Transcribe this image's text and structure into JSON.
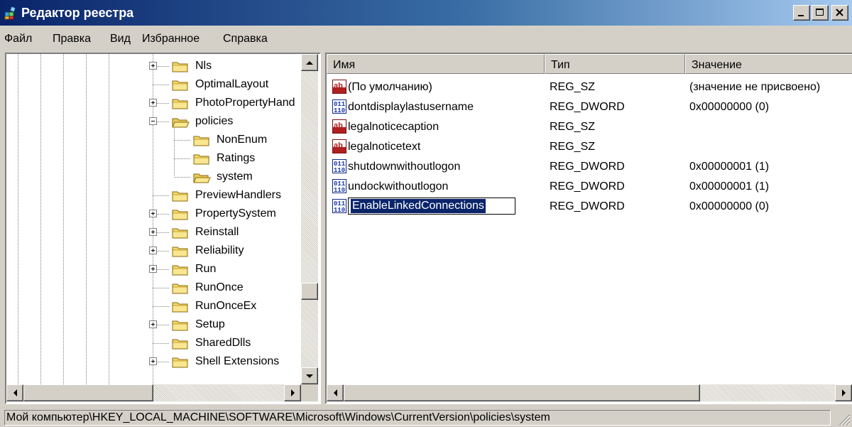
{
  "window": {
    "title": "Редактор реестра"
  },
  "menu": [
    "Файл",
    "Правка",
    "Вид",
    "Избранное",
    "Справка"
  ],
  "tree": {
    "items": [
      {
        "label": "Nls",
        "expander": "plus",
        "indent": 0,
        "open": false
      },
      {
        "label": "OptimalLayout",
        "expander": "none",
        "indent": 0,
        "open": false
      },
      {
        "label": "PhotoPropertyHand",
        "expander": "plus",
        "indent": 0,
        "open": false
      },
      {
        "label": "policies",
        "expander": "minus",
        "indent": 0,
        "open": true
      },
      {
        "label": "NonEnum",
        "expander": "none",
        "indent": 1,
        "open": false
      },
      {
        "label": "Ratings",
        "expander": "none",
        "indent": 1,
        "open": false
      },
      {
        "label": "system",
        "expander": "none",
        "indent": 1,
        "open": true
      },
      {
        "label": "PreviewHandlers",
        "expander": "none",
        "indent": 0,
        "open": false
      },
      {
        "label": "PropertySystem",
        "expander": "plus",
        "indent": 0,
        "open": false
      },
      {
        "label": "Reinstall",
        "expander": "plus",
        "indent": 0,
        "open": false
      },
      {
        "label": "Reliability",
        "expander": "plus",
        "indent": 0,
        "open": false
      },
      {
        "label": "Run",
        "expander": "plus",
        "indent": 0,
        "open": false
      },
      {
        "label": "RunOnce",
        "expander": "none",
        "indent": 0,
        "open": false
      },
      {
        "label": "RunOnceEx",
        "expander": "none",
        "indent": 0,
        "open": false
      },
      {
        "label": "Setup",
        "expander": "plus",
        "indent": 0,
        "open": false
      },
      {
        "label": "SharedDlls",
        "expander": "none",
        "indent": 0,
        "open": false
      },
      {
        "label": "Shell Extensions",
        "expander": "plus",
        "indent": 0,
        "open": false
      }
    ]
  },
  "list": {
    "columns": [
      "Имя",
      "Тип",
      "Значение"
    ],
    "rows": [
      {
        "icon": "string-value-icon",
        "name": "(По умолчанию)",
        "type": "REG_SZ",
        "value": "(значение не присвоено)"
      },
      {
        "icon": "binary-value-icon",
        "name": "dontdisplaylastusername",
        "type": "REG_DWORD",
        "value": "0x00000000 (0)"
      },
      {
        "icon": "string-value-icon",
        "name": "legalnoticecaption",
        "type": "REG_SZ",
        "value": ""
      },
      {
        "icon": "string-value-icon",
        "name": "legalnoticetext",
        "type": "REG_SZ",
        "value": ""
      },
      {
        "icon": "binary-value-icon",
        "name": "shutdownwithoutlogon",
        "type": "REG_DWORD",
        "value": "0x00000001 (1)"
      },
      {
        "icon": "binary-value-icon",
        "name": "undockwithoutlogon",
        "type": "REG_DWORD",
        "value": "0x00000001 (1)"
      },
      {
        "icon": "binary-value-icon",
        "name": "EnableLinkedConnections",
        "type": "REG_DWORD",
        "value": "0x00000000 (0)",
        "editing": true
      }
    ]
  },
  "status": {
    "path": "Мой компьютер\\HKEY_LOCAL_MACHINE\\SOFTWARE\\Microsoft\\Windows\\CurrentVersion\\policies\\system"
  }
}
